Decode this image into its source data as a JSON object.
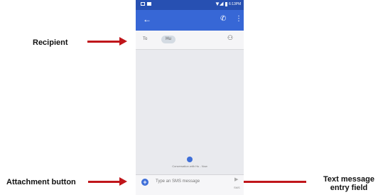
{
  "annotations": {
    "recipient": "Recipient",
    "attachment": "Attachment button",
    "text_field": "Text message\nentry field"
  },
  "status_bar": {
    "time": "6:13PM"
  },
  "recipient": {
    "to_label": "To",
    "chip_text": "Hu"
  },
  "conversation": {
    "info_text": "Conversation with Hu - Now"
  },
  "composer": {
    "placeholder": "Type an SMS message",
    "send_label": "SMS"
  },
  "colors": {
    "app_bar": "#3767d6",
    "status_bar": "#2750b2",
    "arrow": "#c0161b",
    "attachment_icon": "#3f6fd8"
  }
}
